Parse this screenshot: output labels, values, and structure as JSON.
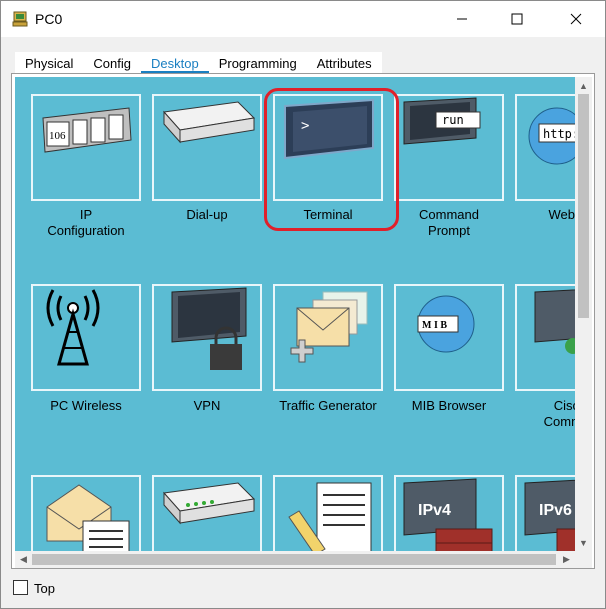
{
  "window": {
    "title": "PC0"
  },
  "tabs": [
    {
      "label": "Physical",
      "active": false
    },
    {
      "label": "Config",
      "active": false
    },
    {
      "label": "Desktop",
      "active": true
    },
    {
      "label": "Programming",
      "active": false
    },
    {
      "label": "Attributes",
      "active": false
    }
  ],
  "desktop": {
    "highlighted": "Terminal",
    "apps": [
      {
        "label_line1": "IP",
        "label_line2": "Configuration",
        "icon_text": "106"
      },
      {
        "label_line1": "Dial-up",
        "label_line2": ""
      },
      {
        "label_line1": "Terminal",
        "label_line2": "",
        "icon_text": ">"
      },
      {
        "label_line1": "Command",
        "label_line2": "Prompt",
        "icon_text": "run"
      },
      {
        "label_line1": "Web Br",
        "label_line2": "",
        "icon_text": "http:"
      },
      {
        "label_line1": "PC Wireless",
        "label_line2": ""
      },
      {
        "label_line1": "VPN",
        "label_line2": ""
      },
      {
        "label_line1": "Traffic Generator",
        "label_line2": ""
      },
      {
        "label_line1": "MIB Browser",
        "label_line2": "",
        "icon_text": "M I B"
      },
      {
        "label_line1": "Cisco",
        "label_line2": "Commun"
      },
      {
        "label_line1": "",
        "label_line2": ""
      },
      {
        "label_line1": "",
        "label_line2": ""
      },
      {
        "label_line1": "",
        "label_line2": ""
      },
      {
        "label_line1": "",
        "label_line2": "",
        "icon_text": "IPv4"
      },
      {
        "label_line1": "",
        "label_line2": "",
        "icon_text": "IPv6"
      }
    ]
  },
  "footer": {
    "top_label": "Top",
    "top_checked": false
  },
  "colors": {
    "desktop_bg": "#5bbcd3",
    "tab_active": "#1a7fc1",
    "highlight": "#e0202a"
  }
}
